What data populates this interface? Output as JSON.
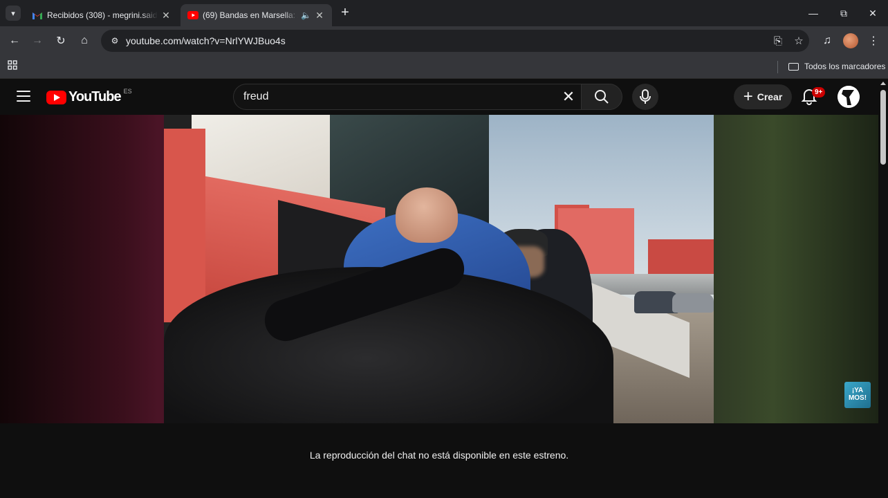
{
  "browser": {
    "tabs": [
      {
        "title": "Recibidos (308) - megrini.saidi@",
        "favicon": "gmail-icon",
        "active": false
      },
      {
        "title": "(69) Bandas en Marsella: Ac",
        "favicon": "youtube-icon",
        "active": true,
        "audio": "speaker-icon"
      }
    ],
    "new_tab_label": "+",
    "url": "youtube.com/watch?v=NrlYWJBuo4s",
    "bookmarks_all_label": "Todos los marcadores"
  },
  "youtube": {
    "logo_text": "YouTube",
    "country_code": "ES",
    "search": {
      "query": "freud",
      "placeholder": "Buscar"
    },
    "create_label": "Crear",
    "notification_count": "9+",
    "brand_color": "#ff0000"
  },
  "video": {
    "watermark_text": "¡YA\nMOS!"
  },
  "chat": {
    "unavailable_message": "La reproducción del chat no está disponible en este estreno."
  }
}
